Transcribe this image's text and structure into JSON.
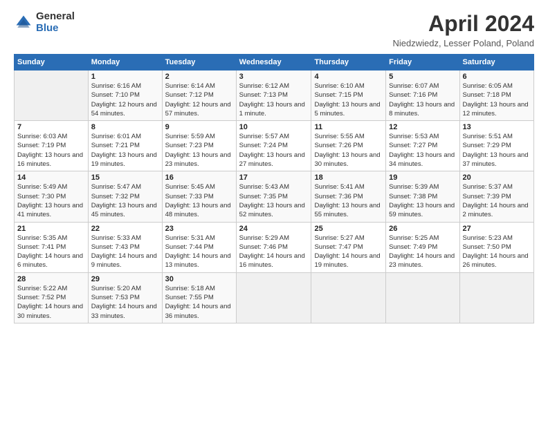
{
  "logo": {
    "general": "General",
    "blue": "Blue"
  },
  "title": "April 2024",
  "subtitle": "Niedzwiedz, Lesser Poland, Poland",
  "days_header": [
    "Sunday",
    "Monday",
    "Tuesday",
    "Wednesday",
    "Thursday",
    "Friday",
    "Saturday"
  ],
  "weeks": [
    [
      {
        "day": "",
        "sunrise": "",
        "sunset": "",
        "daylight": ""
      },
      {
        "day": "1",
        "sunrise": "Sunrise: 6:16 AM",
        "sunset": "Sunset: 7:10 PM",
        "daylight": "Daylight: 12 hours and 54 minutes."
      },
      {
        "day": "2",
        "sunrise": "Sunrise: 6:14 AM",
        "sunset": "Sunset: 7:12 PM",
        "daylight": "Daylight: 12 hours and 57 minutes."
      },
      {
        "day": "3",
        "sunrise": "Sunrise: 6:12 AM",
        "sunset": "Sunset: 7:13 PM",
        "daylight": "Daylight: 13 hours and 1 minute."
      },
      {
        "day": "4",
        "sunrise": "Sunrise: 6:10 AM",
        "sunset": "Sunset: 7:15 PM",
        "daylight": "Daylight: 13 hours and 5 minutes."
      },
      {
        "day": "5",
        "sunrise": "Sunrise: 6:07 AM",
        "sunset": "Sunset: 7:16 PM",
        "daylight": "Daylight: 13 hours and 8 minutes."
      },
      {
        "day": "6",
        "sunrise": "Sunrise: 6:05 AM",
        "sunset": "Sunset: 7:18 PM",
        "daylight": "Daylight: 13 hours and 12 minutes."
      }
    ],
    [
      {
        "day": "7",
        "sunrise": "Sunrise: 6:03 AM",
        "sunset": "Sunset: 7:19 PM",
        "daylight": "Daylight: 13 hours and 16 minutes."
      },
      {
        "day": "8",
        "sunrise": "Sunrise: 6:01 AM",
        "sunset": "Sunset: 7:21 PM",
        "daylight": "Daylight: 13 hours and 19 minutes."
      },
      {
        "day": "9",
        "sunrise": "Sunrise: 5:59 AM",
        "sunset": "Sunset: 7:23 PM",
        "daylight": "Daylight: 13 hours and 23 minutes."
      },
      {
        "day": "10",
        "sunrise": "Sunrise: 5:57 AM",
        "sunset": "Sunset: 7:24 PM",
        "daylight": "Daylight: 13 hours and 27 minutes."
      },
      {
        "day": "11",
        "sunrise": "Sunrise: 5:55 AM",
        "sunset": "Sunset: 7:26 PM",
        "daylight": "Daylight: 13 hours and 30 minutes."
      },
      {
        "day": "12",
        "sunrise": "Sunrise: 5:53 AM",
        "sunset": "Sunset: 7:27 PM",
        "daylight": "Daylight: 13 hours and 34 minutes."
      },
      {
        "day": "13",
        "sunrise": "Sunrise: 5:51 AM",
        "sunset": "Sunset: 7:29 PM",
        "daylight": "Daylight: 13 hours and 37 minutes."
      }
    ],
    [
      {
        "day": "14",
        "sunrise": "Sunrise: 5:49 AM",
        "sunset": "Sunset: 7:30 PM",
        "daylight": "Daylight: 13 hours and 41 minutes."
      },
      {
        "day": "15",
        "sunrise": "Sunrise: 5:47 AM",
        "sunset": "Sunset: 7:32 PM",
        "daylight": "Daylight: 13 hours and 45 minutes."
      },
      {
        "day": "16",
        "sunrise": "Sunrise: 5:45 AM",
        "sunset": "Sunset: 7:33 PM",
        "daylight": "Daylight: 13 hours and 48 minutes."
      },
      {
        "day": "17",
        "sunrise": "Sunrise: 5:43 AM",
        "sunset": "Sunset: 7:35 PM",
        "daylight": "Daylight: 13 hours and 52 minutes."
      },
      {
        "day": "18",
        "sunrise": "Sunrise: 5:41 AM",
        "sunset": "Sunset: 7:36 PM",
        "daylight": "Daylight: 13 hours and 55 minutes."
      },
      {
        "day": "19",
        "sunrise": "Sunrise: 5:39 AM",
        "sunset": "Sunset: 7:38 PM",
        "daylight": "Daylight: 13 hours and 59 minutes."
      },
      {
        "day": "20",
        "sunrise": "Sunrise: 5:37 AM",
        "sunset": "Sunset: 7:39 PM",
        "daylight": "Daylight: 14 hours and 2 minutes."
      }
    ],
    [
      {
        "day": "21",
        "sunrise": "Sunrise: 5:35 AM",
        "sunset": "Sunset: 7:41 PM",
        "daylight": "Daylight: 14 hours and 6 minutes."
      },
      {
        "day": "22",
        "sunrise": "Sunrise: 5:33 AM",
        "sunset": "Sunset: 7:43 PM",
        "daylight": "Daylight: 14 hours and 9 minutes."
      },
      {
        "day": "23",
        "sunrise": "Sunrise: 5:31 AM",
        "sunset": "Sunset: 7:44 PM",
        "daylight": "Daylight: 14 hours and 13 minutes."
      },
      {
        "day": "24",
        "sunrise": "Sunrise: 5:29 AM",
        "sunset": "Sunset: 7:46 PM",
        "daylight": "Daylight: 14 hours and 16 minutes."
      },
      {
        "day": "25",
        "sunrise": "Sunrise: 5:27 AM",
        "sunset": "Sunset: 7:47 PM",
        "daylight": "Daylight: 14 hours and 19 minutes."
      },
      {
        "day": "26",
        "sunrise": "Sunrise: 5:25 AM",
        "sunset": "Sunset: 7:49 PM",
        "daylight": "Daylight: 14 hours and 23 minutes."
      },
      {
        "day": "27",
        "sunrise": "Sunrise: 5:23 AM",
        "sunset": "Sunset: 7:50 PM",
        "daylight": "Daylight: 14 hours and 26 minutes."
      }
    ],
    [
      {
        "day": "28",
        "sunrise": "Sunrise: 5:22 AM",
        "sunset": "Sunset: 7:52 PM",
        "daylight": "Daylight: 14 hours and 30 minutes."
      },
      {
        "day": "29",
        "sunrise": "Sunrise: 5:20 AM",
        "sunset": "Sunset: 7:53 PM",
        "daylight": "Daylight: 14 hours and 33 minutes."
      },
      {
        "day": "30",
        "sunrise": "Sunrise: 5:18 AM",
        "sunset": "Sunset: 7:55 PM",
        "daylight": "Daylight: 14 hours and 36 minutes."
      },
      {
        "day": "",
        "sunrise": "",
        "sunset": "",
        "daylight": ""
      },
      {
        "day": "",
        "sunrise": "",
        "sunset": "",
        "daylight": ""
      },
      {
        "day": "",
        "sunrise": "",
        "sunset": "",
        "daylight": ""
      },
      {
        "day": "",
        "sunrise": "",
        "sunset": "",
        "daylight": ""
      }
    ]
  ]
}
